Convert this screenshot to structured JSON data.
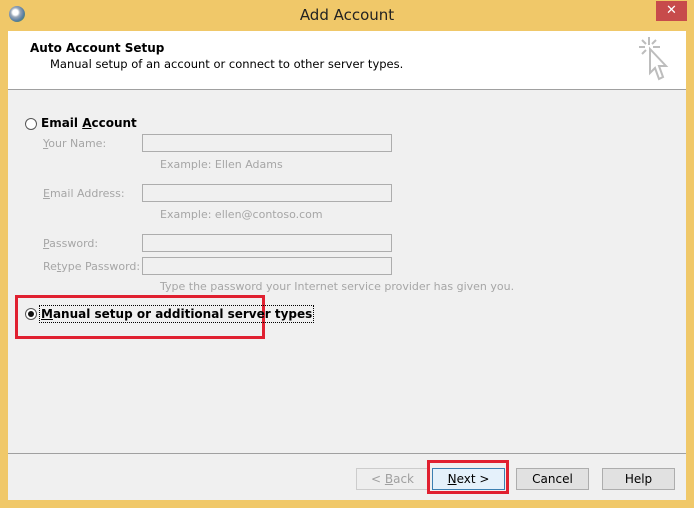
{
  "window": {
    "title": "Add Account",
    "close_label": "✕"
  },
  "header": {
    "title": "Auto Account Setup",
    "subtitle": "Manual setup of an account or connect to other server types."
  },
  "options": {
    "email_account": {
      "label_prefix": "Email ",
      "label_accel": "A",
      "label_rest": "ccount",
      "selected": false
    },
    "manual_setup": {
      "label_accel": "M",
      "label_rest": "anual setup or additional server types",
      "selected": true
    }
  },
  "fields": {
    "your_name": {
      "label_accel": "Y",
      "label_rest": "our Name:",
      "value": "",
      "hint": "Example: Ellen Adams"
    },
    "email_address": {
      "label_accel": "E",
      "label_rest": "mail Address:",
      "value": "",
      "hint": "Example: ellen@contoso.com"
    },
    "password": {
      "label_accel": "P",
      "label_rest": "assword:",
      "value": ""
    },
    "retype_password": {
      "label_pre": "Re",
      "label_accel": "t",
      "label_rest": "ype Password:",
      "value": "",
      "hint": "Type the password your Internet service provider has given you."
    }
  },
  "buttons": {
    "back": {
      "pre": "< ",
      "accel": "B",
      "rest": "ack"
    },
    "next": {
      "accel": "N",
      "rest": "ext >"
    },
    "cancel": "Cancel",
    "help": "Help"
  },
  "colors": {
    "titlebar": "#f0c869",
    "close": "#c74b4b",
    "highlight": "#e02030"
  }
}
